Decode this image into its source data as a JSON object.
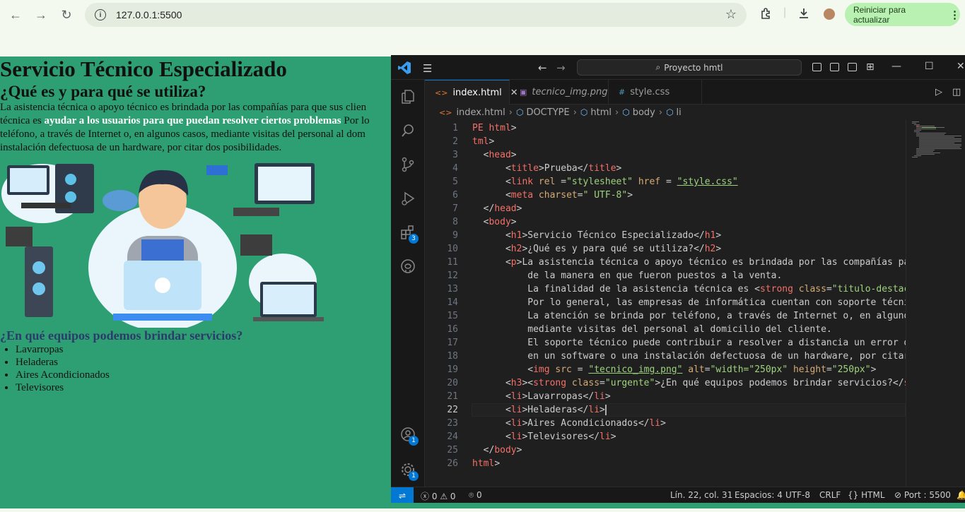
{
  "browser": {
    "url": "127.0.0.1:5500",
    "restart_label": "Reiniciar para actualizar"
  },
  "page": {
    "h1": "Servicio Técnico Especializado",
    "h2": "¿Qué es y para qué se utiliza?",
    "p_line1": "La asistencia técnica o apoyo técnico es brindada por las compañías para que sus clien",
    "p_line2_pre": "técnica es ",
    "p_line2_strong": "ayudar a los usuarios para que puedan resolver ciertos problemas",
    "p_line2_post": " Por lo",
    "p_line3": "teléfono, a través de Internet o, en algunos casos, mediante visitas del personal al dom",
    "p_line4": "instalación defectuosa de un hardware, por citar dos posibilidades.",
    "h3": "¿En qué equipos podemos brindar servicios?",
    "list": [
      "Lavarropas",
      "Heladeras",
      "Aires Acondicionados",
      "Televisores"
    ]
  },
  "vscode": {
    "search_label": "Proyecto hmtl",
    "tabs": [
      {
        "label": "index.html",
        "active": true
      },
      {
        "label": "tecnico_img.png",
        "active": false
      },
      {
        "label": "style.css",
        "active": false
      }
    ],
    "breadcrumb": [
      "index.html",
      "DOCTYPE",
      "html",
      "body",
      "li"
    ],
    "activity_badges": {
      "extensions": "3",
      "accounts": "1",
      "settings": "1"
    },
    "current_line": 22,
    "line_numbers": [
      "1",
      "2",
      "3",
      "4",
      "5",
      "6",
      "7",
      "8",
      "9",
      "10",
      "11",
      "12",
      "13",
      "14",
      "15",
      "16",
      "17",
      "18",
      "19",
      "20",
      "21",
      "22",
      "23",
      "24",
      "25",
      "26"
    ],
    "status": {
      "errors": "0",
      "warnings": "0",
      "ports": "0",
      "position": "Lín. 22, col. 31",
      "spaces": "Espacios: 4",
      "encoding": "UTF-8",
      "eol": "CRLF",
      "language": "HTML",
      "port": "Port : 5500"
    },
    "code": [
      [
        [
          "tg",
          "PE html"
        ],
        [
          "",
          "&gt;"
        ]
      ],
      [
        [
          "tg",
          "tml"
        ],
        [
          "",
          "&gt;"
        ]
      ],
      [
        [
          "",
          "  &lt;"
        ],
        [
          "tg",
          "head"
        ],
        [
          "",
          "&gt;"
        ]
      ],
      [
        [
          "",
          "      &lt;"
        ],
        [
          "tg",
          "title"
        ],
        [
          "",
          "&gt;Prueba&lt;/"
        ],
        [
          "tg",
          "title"
        ],
        [
          "",
          "&gt;"
        ]
      ],
      [
        [
          "",
          "      &lt;"
        ],
        [
          "tg",
          "link"
        ],
        [
          "at",
          " rel"
        ],
        [
          "",
          " ="
        ],
        [
          "st",
          "\"stylesheet\""
        ],
        [
          "at",
          " href"
        ],
        [
          "",
          " = "
        ],
        [
          "st lk",
          "\"style.css\""
        ]
      ],
      [
        [
          "",
          "      &lt;"
        ],
        [
          "tg",
          "meta"
        ],
        [
          "at",
          " charset"
        ],
        [
          "",
          "="
        ],
        [
          "st",
          "\" UTF-8\""
        ],
        [
          "",
          "&gt;"
        ]
      ],
      [
        [
          "",
          "  &lt;/"
        ],
        [
          "tg",
          "head"
        ],
        [
          "",
          "&gt;"
        ]
      ],
      [
        [
          "",
          "  &lt;"
        ],
        [
          "tg",
          "body"
        ],
        [
          "",
          "&gt;"
        ]
      ],
      [
        [
          "",
          "      &lt;"
        ],
        [
          "tg",
          "h1"
        ],
        [
          "",
          "&gt;Servicio Técnico Especializado&lt;/"
        ],
        [
          "tg",
          "h1"
        ],
        [
          "",
          "&gt;"
        ]
      ],
      [
        [
          "",
          "      &lt;"
        ],
        [
          "tg",
          "h2"
        ],
        [
          "",
          "&gt;¿Qué es y para qué se utiliza?&lt;/"
        ],
        [
          "tg",
          "h2"
        ],
        [
          "",
          "&gt;"
        ]
      ],
      [
        [
          "",
          "      &lt;"
        ],
        [
          "tg",
          "p"
        ],
        [
          "",
          "&gt;La asistencia técnica o apoyo técnico es brindada por las compañías par"
        ]
      ],
      [
        [
          "",
          "          de la manera en que fueron puestos a la venta."
        ]
      ],
      [
        [
          "",
          "          La finalidad de la asistencia técnica es &lt;"
        ],
        [
          "tg",
          "strong"
        ],
        [
          "at",
          " class"
        ],
        [
          "",
          "="
        ],
        [
          "st",
          "\"titulo-destaca"
        ]
      ],
      [
        [
          "",
          "          Por lo general, las empresas de informática cuentan con soporte técnic"
        ]
      ],
      [
        [
          "",
          "          La atención se brinda por teléfono, a través de Internet o, en algunos"
        ]
      ],
      [
        [
          "",
          "          mediante visitas del personal al domicilio del cliente."
        ]
      ],
      [
        [
          "",
          "          El soporte técnico puede contribuir a resolver a distancia un error de"
        ]
      ],
      [
        [
          "",
          "          en un software o una instalación defectuosa de un hardware, por citar"
        ]
      ],
      [
        [
          "",
          "          &lt;"
        ],
        [
          "tg",
          "img"
        ],
        [
          "at",
          " src"
        ],
        [
          "",
          " = "
        ],
        [
          "st lk",
          "\"tecnico_img.png\""
        ],
        [
          "at",
          " alt"
        ],
        [
          "",
          "="
        ],
        [
          "st",
          "\"width=\"250px\""
        ],
        [
          "at",
          " height"
        ],
        [
          "",
          "="
        ],
        [
          "st",
          "\"250px\""
        ],
        [
          "",
          "&gt;"
        ]
      ],
      [
        [
          "",
          "      &lt;"
        ],
        [
          "tg",
          "h3"
        ],
        [
          "",
          "&gt;&lt;"
        ],
        [
          "tg",
          "strong"
        ],
        [
          "at",
          " class"
        ],
        [
          "",
          "="
        ],
        [
          "st",
          "\"urgente\""
        ],
        [
          "",
          "&gt;¿En qué equipos podemos brindar servicios?&lt;/"
        ],
        [
          "tg",
          "st"
        ]
      ],
      [
        [
          "",
          "      &lt;"
        ],
        [
          "tg",
          "li"
        ],
        [
          "",
          "&gt;Lavarropas&lt;/"
        ],
        [
          "tg",
          "li"
        ],
        [
          "",
          "&gt;"
        ]
      ],
      [
        [
          "",
          "      &lt;"
        ],
        [
          "tg",
          "li"
        ],
        [
          "",
          "&gt;Heladeras&lt;/"
        ],
        [
          "tg",
          "li"
        ],
        [
          "",
          "&gt;"
        ]
      ],
      [
        [
          "",
          "      &lt;"
        ],
        [
          "tg",
          "li"
        ],
        [
          "",
          "&gt;Aires Acondicionados&lt;/"
        ],
        [
          "tg",
          "li"
        ],
        [
          "",
          "&gt;"
        ]
      ],
      [
        [
          "",
          "      &lt;"
        ],
        [
          "tg",
          "li"
        ],
        [
          "",
          "&gt;Televisores&lt;/"
        ],
        [
          "tg",
          "li"
        ],
        [
          "",
          "&gt;"
        ]
      ],
      [
        [
          "",
          "  &lt;/"
        ],
        [
          "tg",
          "body"
        ],
        [
          "",
          "&gt;"
        ]
      ],
      [
        [
          "tg",
          "html"
        ],
        [
          "",
          "&gt;"
        ]
      ]
    ]
  }
}
